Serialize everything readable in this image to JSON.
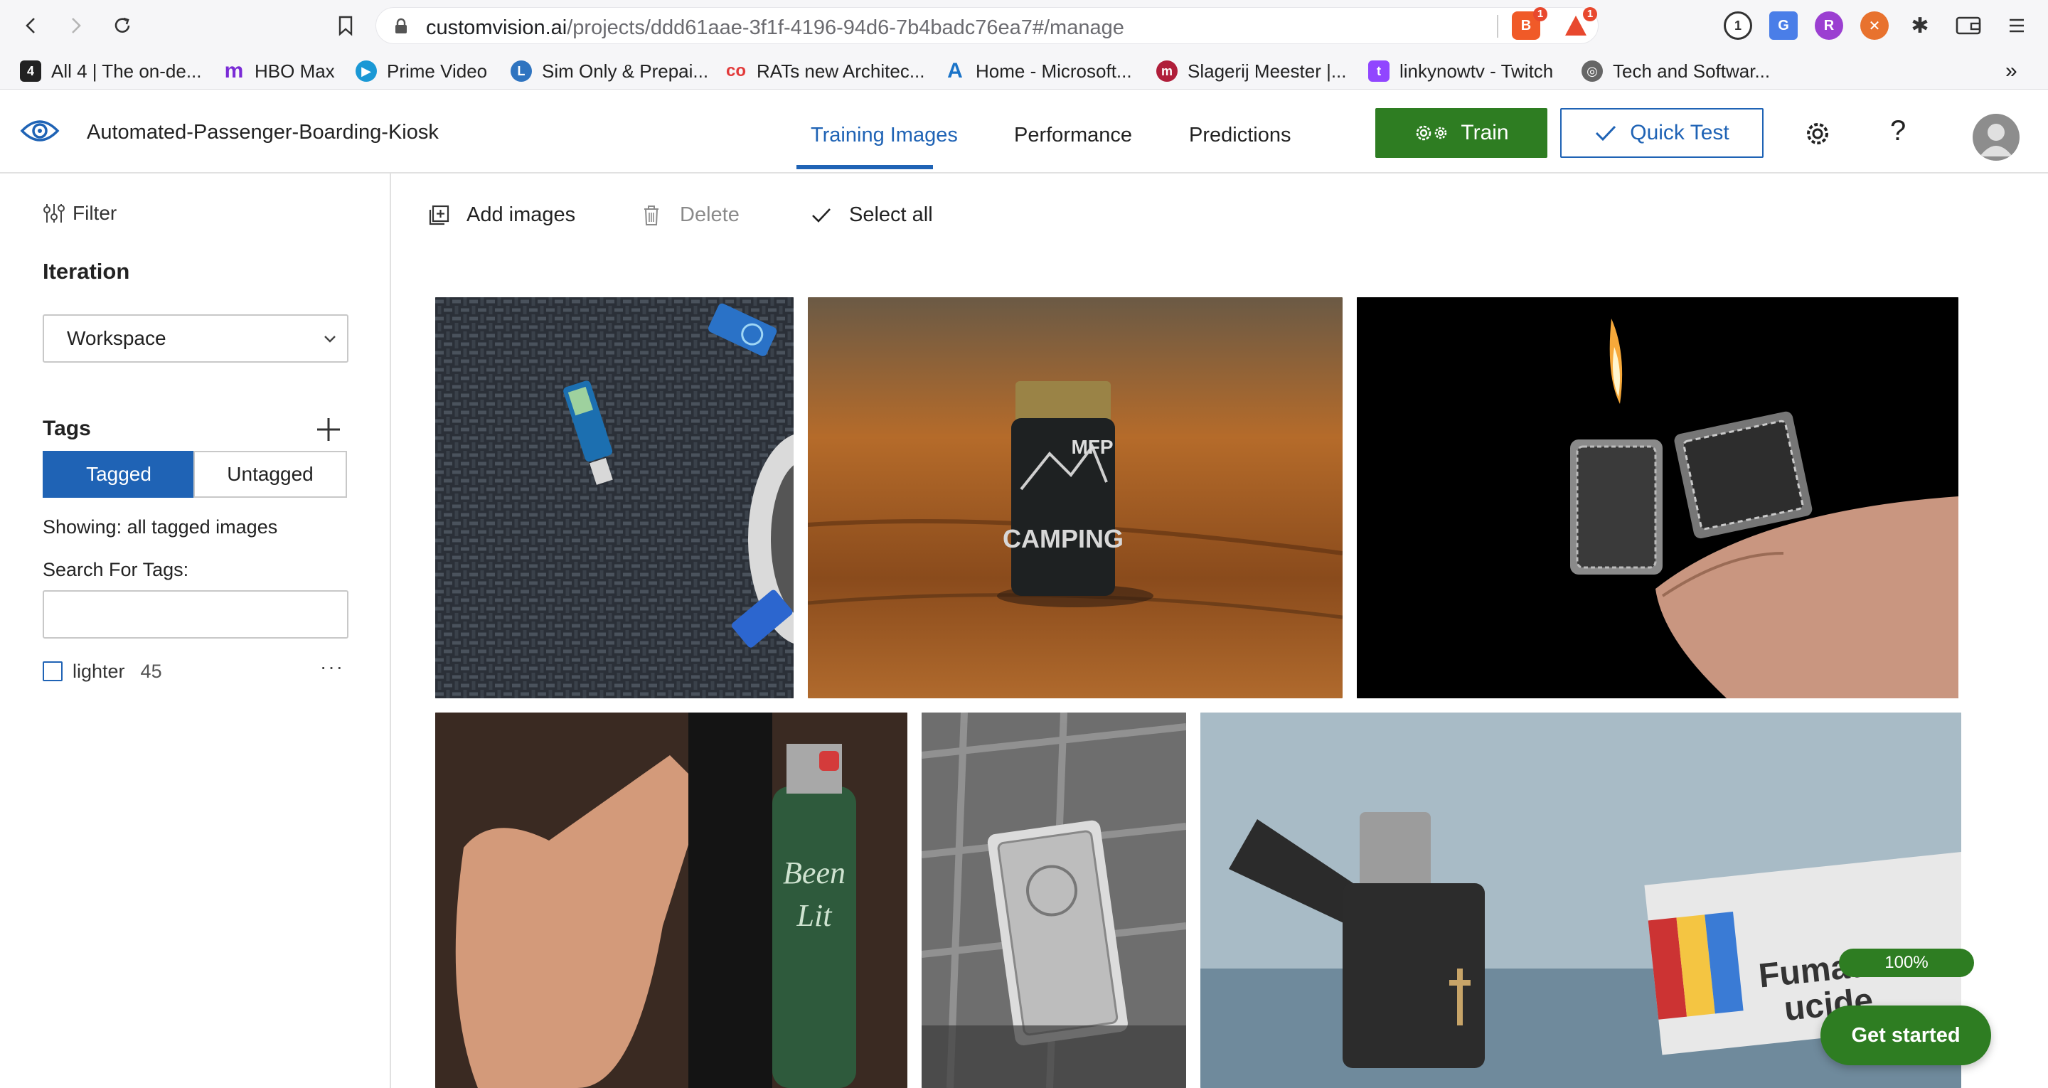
{
  "browser": {
    "url_host": "customvision.ai",
    "url_path": "/projects/ddd61aae-3f1f-4196-94d6-7b4badc76ea7#/manage",
    "brave_badge": "1",
    "alert_badge": "1"
  },
  "bookmarks": [
    {
      "label": "All 4 | The on-de...",
      "icon": "channel4-icon",
      "color": "#222222"
    },
    {
      "label": "HBO Max",
      "icon": "hbomax-icon",
      "color": "#7a2bd6"
    },
    {
      "label": "Prime Video",
      "icon": "prime-video-icon",
      "color": "#1a98d5"
    },
    {
      "label": "Sim Only & Prepai...",
      "icon": "sim-icon",
      "color": "#2f74c0"
    },
    {
      "label": "RATs new Architec...",
      "icon": "rats-icon",
      "color": "#e23a3a"
    },
    {
      "label": "Home - Microsoft...",
      "icon": "azure-icon",
      "color": "#1a73c8"
    },
    {
      "label": "Slagerij Meester |...",
      "icon": "slagerij-icon",
      "color": "#b01e3a"
    },
    {
      "label": "linkynowtv - Twitch",
      "icon": "twitch-icon",
      "color": "#9146ff"
    },
    {
      "label": "Tech and Softwar...",
      "icon": "globe-icon",
      "color": "#666666"
    }
  ],
  "app": {
    "project_title": "Automated-Passenger-Boarding-Kiosk",
    "tabs": [
      "Training Images",
      "Performance",
      "Predictions"
    ],
    "active_tab": "Training Images",
    "train_label": "Train",
    "quick_test_label": "Quick Test"
  },
  "sidebar": {
    "filter_label": "Filter",
    "iteration_title": "Iteration",
    "iteration_value": "Workspace",
    "tags_title": "Tags",
    "tagged_label": "Tagged",
    "untagged_label": "Untagged",
    "showing_text": "Showing: all tagged images",
    "search_label": "Search For Tags:",
    "tags": [
      {
        "name": "lighter",
        "count": "45"
      }
    ]
  },
  "toolbar": {
    "add_images": "Add images",
    "delete": "Delete",
    "select_all": "Select all"
  },
  "images": [
    {
      "subject": "blue disposable lighters on woven mat",
      "tag": "lighter"
    },
    {
      "subject": "black camping lighter on wooden table",
      "tag": "lighter"
    },
    {
      "subject": "lit engraved zippo lighter in hand",
      "tag": "lighter"
    },
    {
      "subject": "green bic lighter held in hand",
      "tag": "lighter"
    },
    {
      "subject": "silver engraved lighter on metal",
      "tag": "lighter"
    },
    {
      "subject": "open black zippo lighter with cigarette pack",
      "tag": "lighter",
      "pack_text": "Fumatul ucide"
    }
  ],
  "floating": {
    "progress_label": "100%",
    "get_started_label": "Get started"
  },
  "colors": {
    "accent_blue": "#1f63b5",
    "train_green": "#2e7d22"
  }
}
